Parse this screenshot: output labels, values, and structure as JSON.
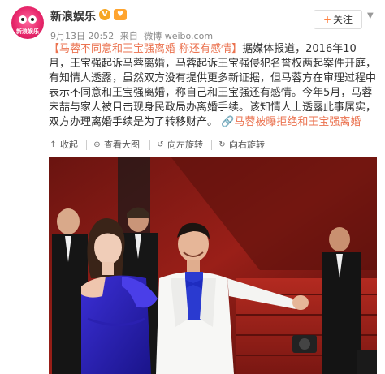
{
  "account": {
    "name": "新浪娱乐",
    "avatar_text": "新浪娱乐",
    "vip_icon": "v-badge-icon",
    "fan_icon": "fan-level-icon"
  },
  "meta": {
    "date": "9月13日 20:52",
    "source_prefix": "来自",
    "source": "微博 weibo.com"
  },
  "follow": {
    "plus": "+",
    "label": "关注",
    "caret_icon": "chevron-down-icon"
  },
  "post": {
    "hashtag": "【马蓉不同意和王宝强离婚 称还有感情】",
    "body": "据媒体报道，2016年10月，王宝强起诉马蓉离婚，马蓉起诉王宝强侵犯名誉权两起案件开庭，有知情人透露，虽然双方没有提供更多新证据，但马蓉方在审理过程中表示不同意和王宝强离婚，称自己和王宝强还有感情。今年5月，马蓉宋喆与家人被目击现身民政局办离婚手续。该知情人士透露此事属实，双方办理离婚手续是为了转移财产。",
    "link_icon": "link-icon",
    "link_text": "马蓉被曝拒绝和王宝强离婚"
  },
  "toolbar": {
    "collapse": "收起",
    "view_large": "查看大图",
    "rotate_left": "向左旋转",
    "rotate_right": "向右旋转"
  },
  "colors": {
    "accent": "#eb7350",
    "brand": "#e8286c",
    "vip": "#f6a623"
  }
}
